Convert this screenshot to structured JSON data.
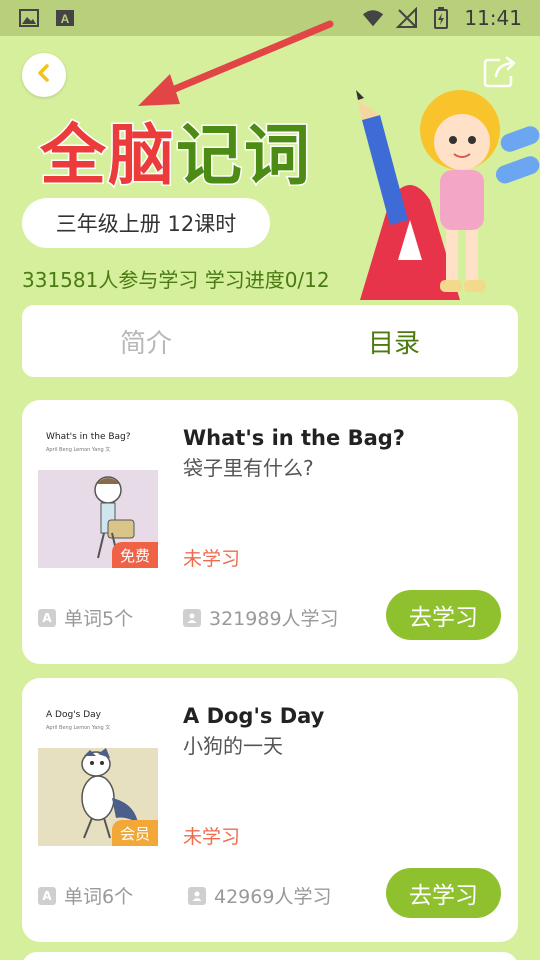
{
  "status_bar": {
    "time": "11:41"
  },
  "hero": {
    "title_red": "全脑",
    "title_green": "记词",
    "grade_label": "三年级上册  12课时",
    "stats": "331581人参与学习  学习进度0/12"
  },
  "tabs": [
    {
      "label": "简介",
      "active": false
    },
    {
      "label": "目录",
      "active": true
    }
  ],
  "lessons": [
    {
      "cover_title": "What's in the Bag?",
      "cover_credits": "April Beng  Lemon Yang 文",
      "en_title": "What's in the Bag?",
      "zh_title": "袋子里有什么?",
      "badge": "免费",
      "status": "未学习",
      "words": "单词5个",
      "learners": "321989人学习",
      "button": "去学习"
    },
    {
      "cover_title": "A Dog's Day",
      "cover_credits": "April Beng  Lemon Yang 文",
      "en_title": "A Dog's Day",
      "zh_title": "小狗的一天",
      "badge": "会员",
      "status": "未学习",
      "words": "单词6个",
      "learners": "42969人学习",
      "button": "去学习"
    }
  ],
  "colors": {
    "background": "#d6ef9c",
    "accent_green": "#8fc12f",
    "title_red": "#ec3b3b",
    "status_orange": "#ef6b4e"
  }
}
